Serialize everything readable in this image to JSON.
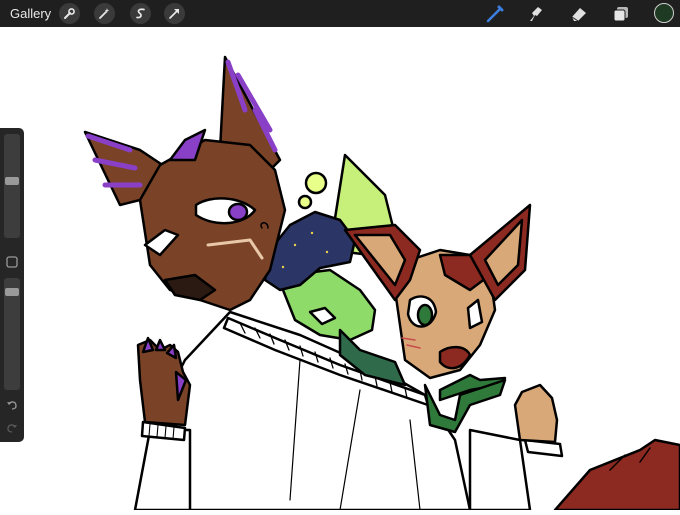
{
  "toolbar": {
    "gallery_label": "Gallery",
    "left_tools": [
      "wrench-icon",
      "magic-wand-icon",
      "selection-icon",
      "transform-arrow-icon"
    ],
    "right_tools": [
      "brush-icon",
      "smudge-icon",
      "eraser-icon",
      "layers-icon"
    ],
    "active_tool": "brush-icon",
    "active_color": "#1e3a22",
    "brush_color": "#3d7fe0"
  },
  "sidebar": {
    "brush_size": 0.55,
    "opacity": 0.9,
    "controls": [
      "modify-square-icon",
      "undo-icon",
      "redo-icon"
    ]
  },
  "palette": {
    "brown": "#7a4328",
    "purple": "#8a3fc7",
    "lime": "#8fdb6a",
    "dark_red": "#8c2a22",
    "tan": "#d9a878",
    "bandana_green": "#2f7a3a",
    "navy": "#2b3566"
  }
}
